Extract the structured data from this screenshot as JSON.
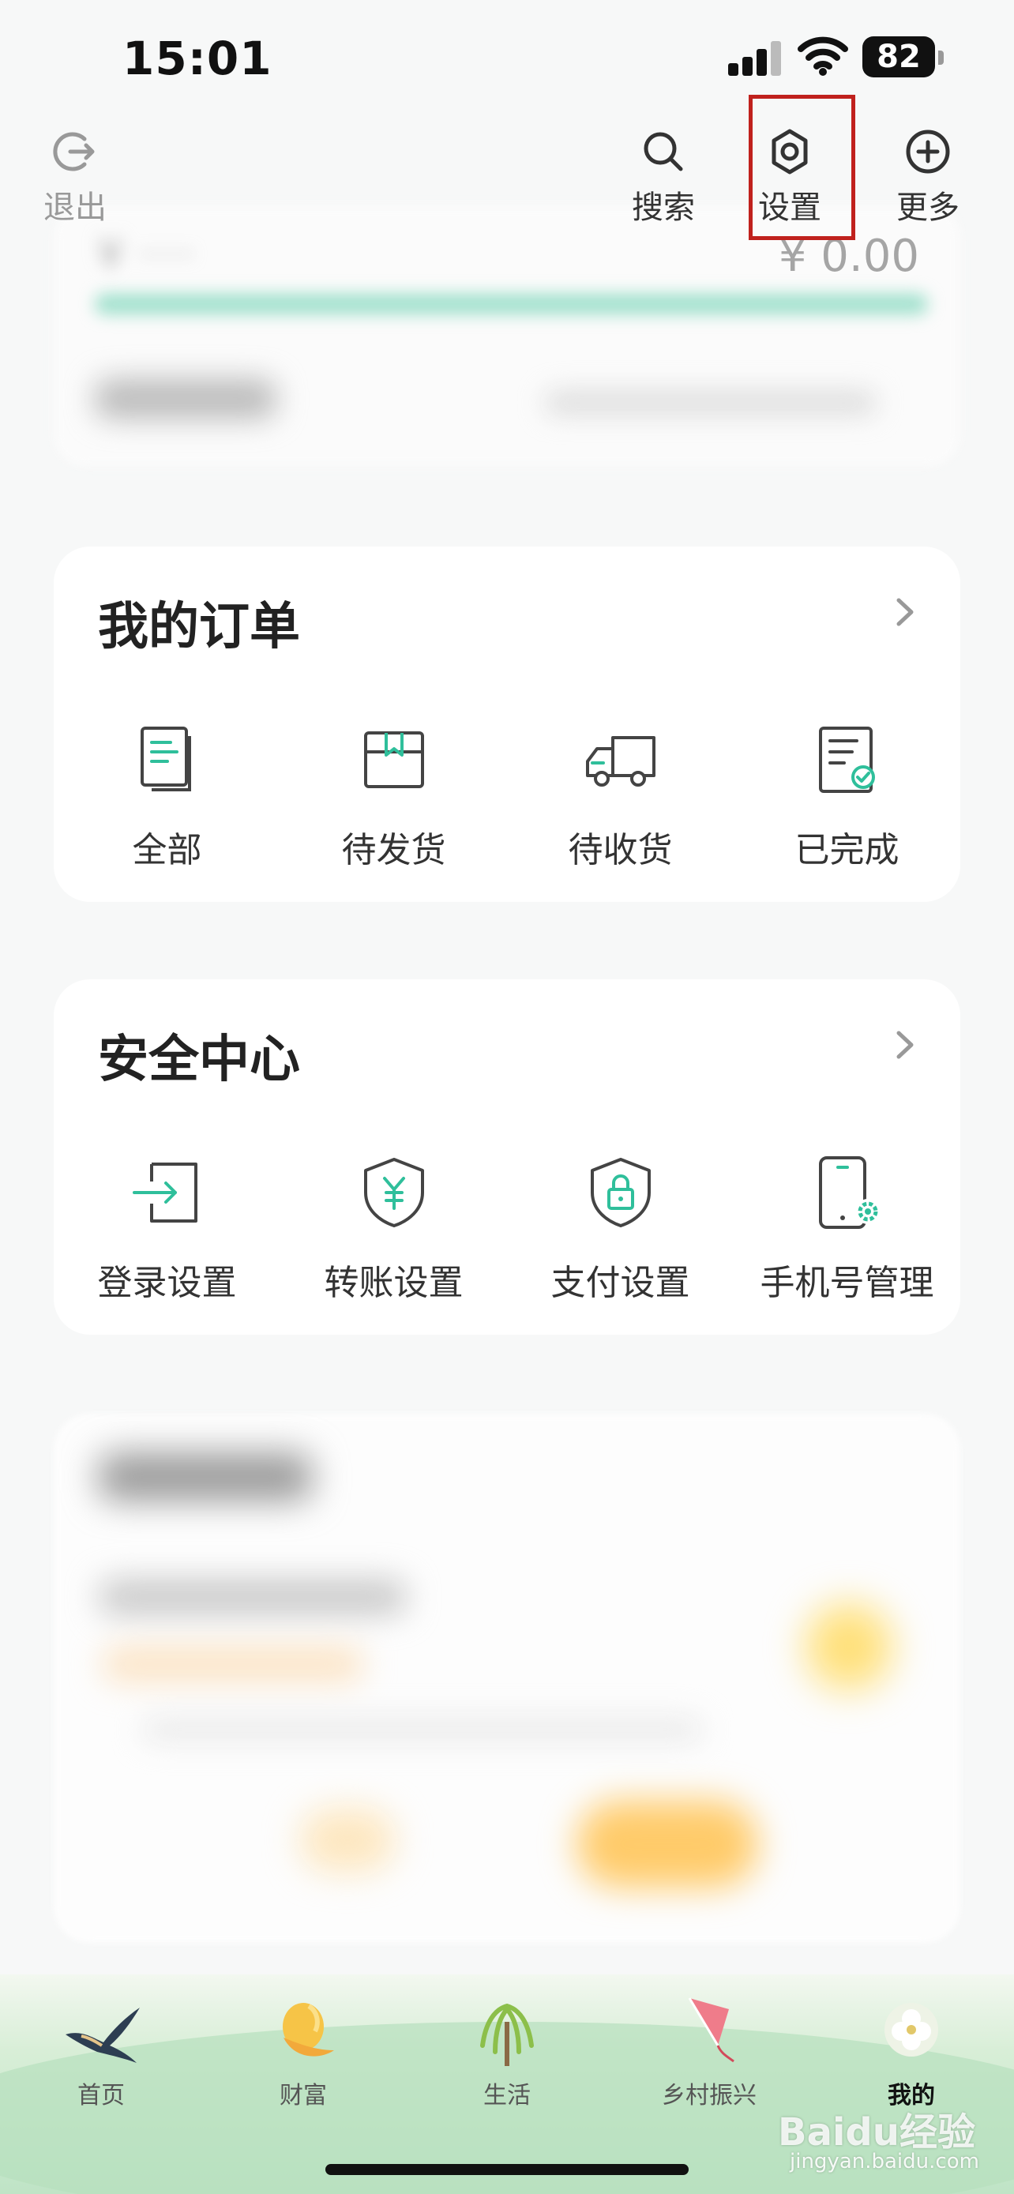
{
  "status_bar": {
    "time": "15:01",
    "battery": "82"
  },
  "toolbar": {
    "exit_label": "退出",
    "search_label": "搜索",
    "settings_label": "设置",
    "more_label": "更多",
    "highlight_color": "#c0211d"
  },
  "assets": {
    "amount": "¥ 0.00"
  },
  "orders": {
    "title": "我的订单",
    "items": [
      {
        "label": "全部",
        "icon": "document-list-icon"
      },
      {
        "label": "待发货",
        "icon": "package-box-icon"
      },
      {
        "label": "待收货",
        "icon": "delivery-truck-icon"
      },
      {
        "label": "已完成",
        "icon": "completed-document-icon"
      }
    ]
  },
  "security": {
    "title": "安全中心",
    "items": [
      {
        "label": "登录设置",
        "icon": "login-arrow-icon"
      },
      {
        "label": "转账设置",
        "icon": "yuan-shield-icon"
      },
      {
        "label": "支付设置",
        "icon": "lock-shield-icon"
      },
      {
        "label": "手机号管理",
        "icon": "phone-gear-icon"
      }
    ]
  },
  "tabbar": {
    "items": [
      {
        "label": "首页",
        "icon": "swallow-icon"
      },
      {
        "label": "财富",
        "icon": "wealth-hat-icon"
      },
      {
        "label": "生活",
        "icon": "willow-tree-icon"
      },
      {
        "label": "乡村振兴",
        "icon": "kite-icon"
      },
      {
        "label": "我的",
        "icon": "flower-icon"
      }
    ],
    "active": "我的"
  },
  "watermark": {
    "brand": "Baidu经验",
    "url": "jingyan.baidu.com"
  },
  "colors": {
    "accent": "#2fbf9b",
    "text": "#333333"
  }
}
